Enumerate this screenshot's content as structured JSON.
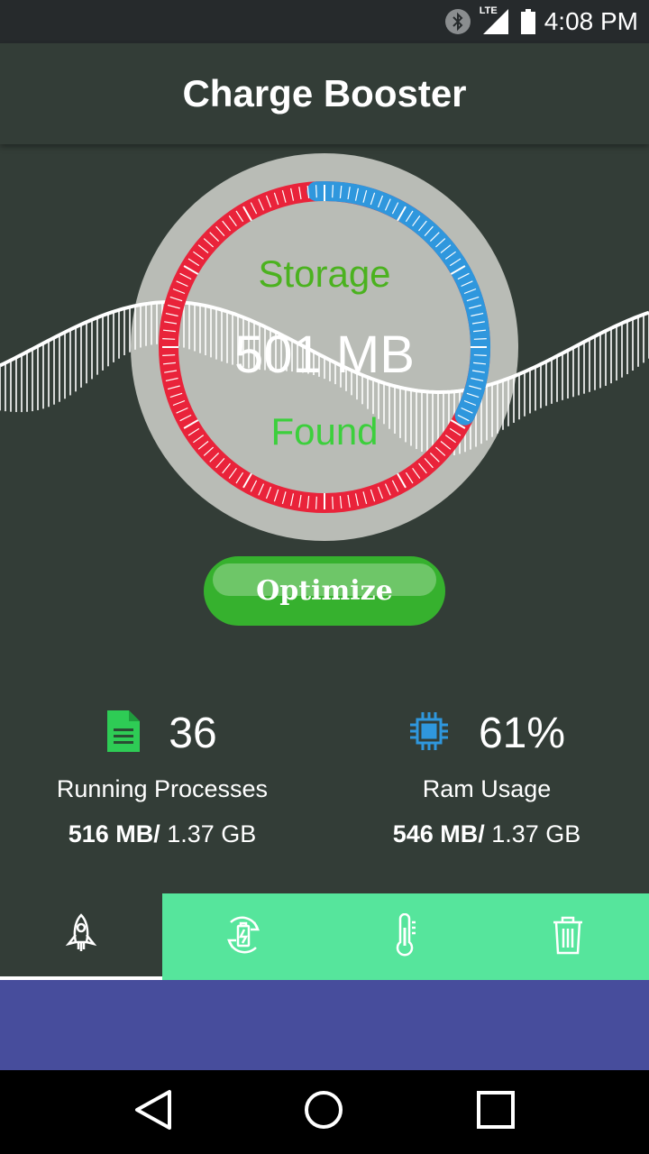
{
  "status_bar": {
    "time": "4:08 PM",
    "network": "LTE",
    "icons": [
      "bluetooth-icon",
      "lte-signal-icon",
      "battery-icon"
    ]
  },
  "app_bar": {
    "title": "Charge Booster"
  },
  "gauge": {
    "top_label": "Storage",
    "value_label": "501 MB",
    "bottom_label": "Found",
    "blue_arc_fraction": 0.33,
    "colors": {
      "red": "#e9233a",
      "blue": "#2f97dd",
      "dial": "#b9bcb6",
      "green": "#4bb21f"
    }
  },
  "optimize_button": {
    "label": "Optimize"
  },
  "stats": {
    "processes": {
      "icon": "document-icon",
      "value": "36",
      "label": "Running Processes",
      "used": "516 MB/",
      "total": " 1.37 GB"
    },
    "ram": {
      "icon": "cpu-chip-icon",
      "value": "61%",
      "label": "Ram Usage",
      "used": "546 MB/",
      "total": " 1.37 GB"
    }
  },
  "tabs": [
    {
      "icon": "rocket-icon",
      "active": true
    },
    {
      "icon": "battery-refresh-icon",
      "active": false
    },
    {
      "icon": "thermometer-icon",
      "active": false
    },
    {
      "icon": "trash-icon",
      "active": false
    }
  ],
  "nav_bar": {
    "icons": [
      "back-icon",
      "home-icon",
      "recents-icon"
    ]
  }
}
